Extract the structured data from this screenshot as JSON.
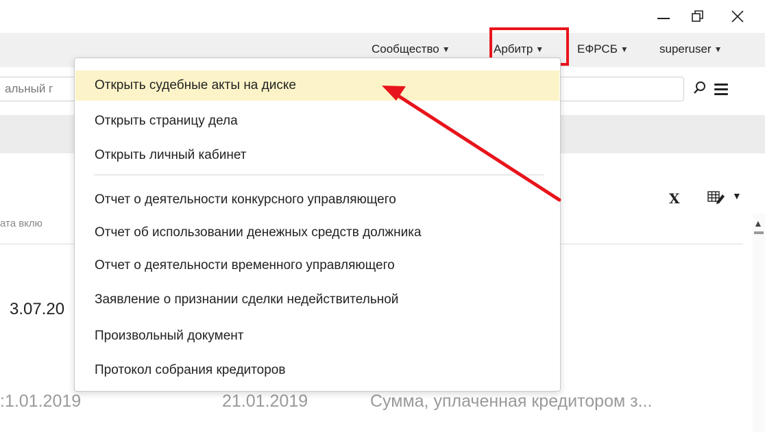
{
  "window": {
    "minimize_glyph": "—",
    "restore_glyph": "❐",
    "close_glyph": "✕"
  },
  "menubar": {
    "items": [
      {
        "label": "Сообщество",
        "chevron": "⌄"
      },
      {
        "label": "Арбитр",
        "chevron": "⌄"
      },
      {
        "label": "ЕФРСБ",
        "chevron": "⌄"
      },
      {
        "label": "superuser",
        "chevron": "⌄"
      }
    ]
  },
  "search": {
    "value": "альный г"
  },
  "dropdown": {
    "items": [
      "Открыть судебные акты на диске",
      "Открыть страницу дела",
      "Открыть личный кабинет",
      "Отчет о деятельности конкурсного управляющего",
      "Отчет об использовании денежных средств должника",
      "Отчет о деятельности временного управляющего",
      "Заявление о признании сделки недействительной",
      "Произвольный документ",
      "Протокол собрания кредиторов"
    ]
  },
  "toolbar": {
    "excel_label": "X",
    "chevron": "⌄"
  },
  "table": {
    "header_partial": "ата вклю",
    "row1_date_partial": "3.07.20",
    "row2": {
      "date_a": ":1.01.2019",
      "date_b": "21.01.2019",
      "text": "Сумма,  уплаченная  кредитором з..."
    }
  },
  "colors": {
    "highlight": "#e8141b",
    "active_item": "#fcf4c8"
  }
}
